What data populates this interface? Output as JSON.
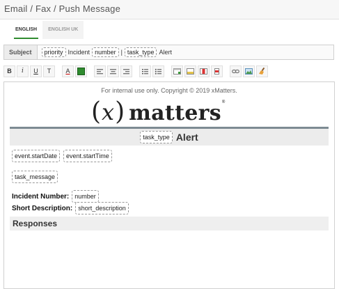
{
  "header": {
    "title": "Email / Fax / Push Message"
  },
  "tabs": [
    {
      "label": "ENGLISH",
      "active": true
    },
    {
      "label": "ENGLISH UK",
      "active": false
    }
  ],
  "subject": {
    "button_label": "Subject",
    "tokens": {
      "priority": "priority",
      "incident": "Incident",
      "number": "number",
      "separator": "|",
      "task_type": "task_type",
      "alert": "Alert"
    }
  },
  "toolbar": {
    "buttons": [
      {
        "icon": "bold-icon",
        "glyph": "B"
      },
      {
        "icon": "italic-icon",
        "glyph": "i"
      },
      {
        "icon": "underline-icon",
        "glyph": "U"
      },
      {
        "icon": "text-icon",
        "glyph": "T"
      },
      {
        "icon": "font-color-icon",
        "glyph": "A"
      },
      {
        "icon": "background-color-icon",
        "color": "#2e8b2e"
      },
      {
        "icon": "align-left-icon"
      },
      {
        "icon": "align-center-icon"
      },
      {
        "icon": "align-right-icon"
      },
      {
        "icon": "ordered-list-icon"
      },
      {
        "icon": "unordered-list-icon"
      },
      {
        "icon": "insert-table-icon"
      },
      {
        "icon": "insert-row-icon"
      },
      {
        "icon": "delete-column-icon"
      },
      {
        "icon": "delete-row-icon"
      },
      {
        "icon": "link-icon"
      },
      {
        "icon": "image-icon"
      },
      {
        "icon": "clean-icon"
      }
    ]
  },
  "editor": {
    "copyright": "For internal use only. Copyright © 2019 xMatters.",
    "logo": {
      "paren_open": "(",
      "x": "x",
      "paren_close": ")",
      "word": "matters",
      "reg": "®"
    },
    "alert": {
      "token": "task_type",
      "word": "Alert"
    },
    "tokens": {
      "start_date": "event.startDate",
      "start_time": "event.startTime",
      "message": "task_message"
    },
    "fields": {
      "incident_label": "Incident Number:",
      "incident_token": "number",
      "short_desc_label": "Short Description:",
      "short_desc_token": "short_description"
    },
    "responses": "Responses"
  }
}
